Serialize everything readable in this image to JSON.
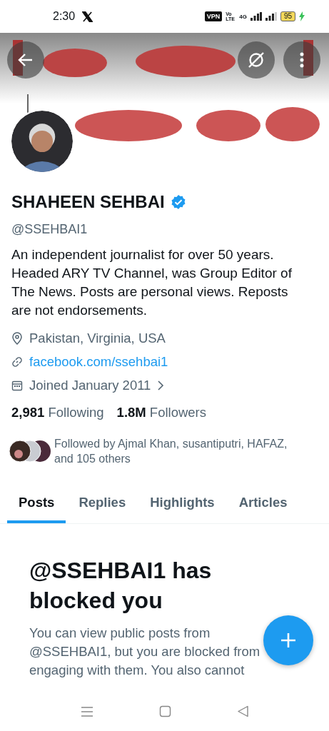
{
  "status_bar": {
    "time": "2:30",
    "vpn": "VPN",
    "volte": "Vo LTE",
    "network": "4G",
    "battery": "95"
  },
  "profile": {
    "name": "SHAHEEN SEHBAI",
    "verified": true,
    "handle": "@SSEHBAI1",
    "bio": "An independent journalist for over 50 years. Headed ARY TV Channel, was Group Editor of The News. Posts are personal views. Reposts are not endorsements.",
    "details": [
      {
        "kind": "location",
        "text": "Pakistan, Virginia, USA"
      },
      {
        "kind": "link",
        "text": "facebook.com/ssehbai1"
      },
      {
        "kind": "joined",
        "text": "Joined January 2011"
      }
    ],
    "stats": [
      {
        "count": "2,981",
        "label": "Following"
      },
      {
        "count": "1.8M",
        "label": "Followers"
      }
    ],
    "followed_by": "Followed by Ajmal Khan, susantiputri, HAFAZ, and 105 others"
  },
  "tabs": [
    {
      "label": "Posts",
      "selected": true
    },
    {
      "label": "Replies",
      "selected": false
    },
    {
      "label": "Highlights",
      "selected": false
    },
    {
      "label": "Articles",
      "selected": false
    }
  ],
  "blocked": {
    "title": "@SSEHBAI1 has blocked you",
    "body": "You can view public posts from @SSEHBAI1, but you are blocked from engaging with them. You also cannot"
  }
}
